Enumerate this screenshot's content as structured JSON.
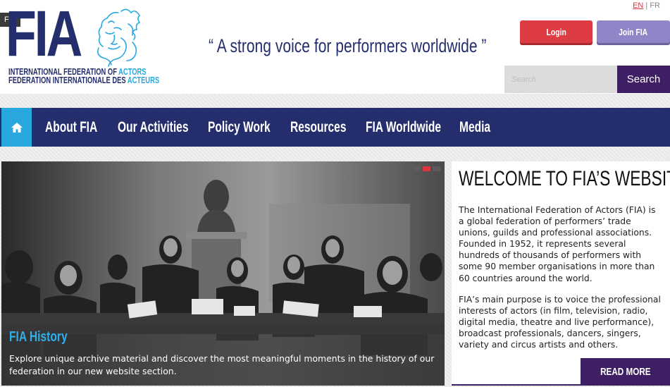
{
  "header": {
    "tag": "FIA",
    "logo": {
      "letters": "FIA",
      "line1_a": "INTERNATIONAL FEDERATION OF ",
      "line1_b": "ACTORS",
      "line2_a": "FEDERATION INTERNATIONALE DES ",
      "line2_b": "ACTEURS"
    },
    "tagline": "“ A strong voice for performers worldwide ”",
    "language": {
      "active": "EN",
      "separator": "|",
      "other": "FR"
    },
    "login_label": "Login",
    "join_label": "Join FIA",
    "search": {
      "placeholder": "Search",
      "value": "",
      "button_label": "Search"
    }
  },
  "nav": {
    "home_icon": "home-icon",
    "items": [
      {
        "label": "About FIA"
      },
      {
        "label": "Our Activities"
      },
      {
        "label": "Policy Work"
      },
      {
        "label": "Resources"
      },
      {
        "label": "FIA Worldwide"
      },
      {
        "label": "Media"
      }
    ]
  },
  "slider": {
    "dots": 4,
    "active_dot": 3,
    "caption_title": "FIA History",
    "caption_text": "Explore unique archive material and discover the most meaningful moments in the history of our federation in our new website section."
  },
  "welcome": {
    "title": "WELCOME TO FIA’S WEBSITE",
    "paragraph1": "The International Federation of Actors (FIA) is a global federation of performers’ trade unions, guilds and professional associations. Founded in 1952, it represents several hundreds of thousands of performers with some 90 member organisations in more than 60 countries around the world.",
    "paragraph2": "FIA’s main purpose is to voice the professional interests of actors (in film, television, radio, digital media, theatre and live performance), broadcast professionals, dancers, singers, variety and circus artists and others.",
    "read_more_label": "READ MORE"
  },
  "colors": {
    "brand_navy": "#252e6c",
    "accent_blue": "#29a8e0",
    "login_red": "#dd3c43",
    "join_lavender": "#8e86c6",
    "purple": "#3f1f64"
  }
}
